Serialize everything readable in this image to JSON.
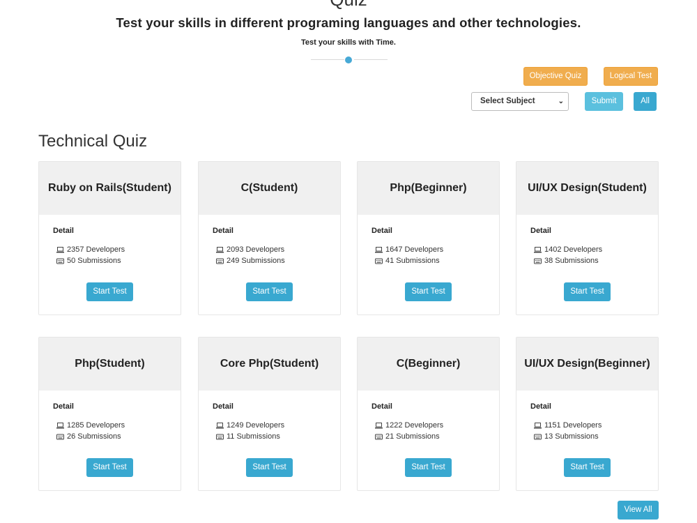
{
  "header": {
    "title": "Quiz",
    "subtitle": "Test your skills in different programing languages and other technologies.",
    "tagline": "Test your skills with Time."
  },
  "filters": {
    "objective_label": "Objective Quiz",
    "logical_label": "Logical Test",
    "subject_select": "Select Subject",
    "submit_label": "Submit",
    "all_label": "All"
  },
  "section_title": "Technical Quiz",
  "card_common": {
    "detail_label": "Detail",
    "start_label": "Start Test"
  },
  "cards": [
    {
      "title": "Ruby on Rails(Student)",
      "developers": "2357 Developers",
      "submissions": "50 Submissions"
    },
    {
      "title": "C(Student)",
      "developers": "2093 Developers",
      "submissions": "249 Submissions"
    },
    {
      "title": "Php(Beginner)",
      "developers": "1647 Developers",
      "submissions": "41 Submissions"
    },
    {
      "title": "UI/UX Design(Student)",
      "developers": "1402 Developers",
      "submissions": "38 Submissions"
    },
    {
      "title": "Php(Student)",
      "developers": "1285 Developers",
      "submissions": "26 Submissions"
    },
    {
      "title": "Core Php(Student)",
      "developers": "1249 Developers",
      "submissions": "11 Submissions"
    },
    {
      "title": "C(Beginner)",
      "developers": "1222 Developers",
      "submissions": "21 Submissions"
    },
    {
      "title": "UI/UX Design(Beginner)",
      "developers": "1151 Developers",
      "submissions": "13 Submissions"
    }
  ],
  "footer": {
    "view_all_label": "View All"
  },
  "icons": {
    "developers": "laptop-icon",
    "submissions": "keyboard-icon"
  },
  "colors": {
    "accent_blue": "#39a8d0",
    "light_blue": "#5bc0de",
    "orange": "#f0ad4e",
    "card_header": "#f0f0f0"
  }
}
